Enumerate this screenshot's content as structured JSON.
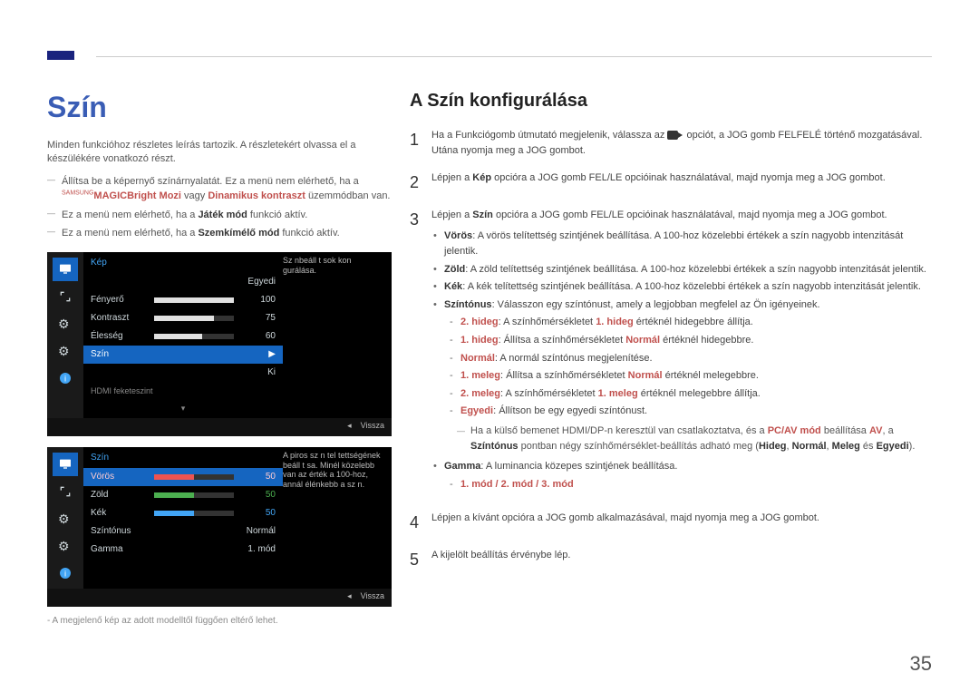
{
  "page_number": "35",
  "section_title": "Szín",
  "intro": "Minden funkcióhoz részletes leírás tartozik. A részletekért olvassa el a készülékére vonatkozó részt.",
  "dash_items": {
    "d1_pre": "Állítsa be a képernyő színárnyalatát. Ez a menü nem elérhető, ha a ",
    "d1_brand_sup": "SAMSUNG",
    "d1_brand_sub": "MAGIC",
    "d1_bright": "Bright",
    "d1_post1": "Mozi",
    "d1_post2": " vagy ",
    "d1_post3": "Dinamikus kontraszt",
    "d1_post4": " üzemmódban van.",
    "d2_pre": "Ez a menü nem elérhető, ha a ",
    "d2_bold": "Játék mód",
    "d2_post": " funkció aktív.",
    "d3_pre": "Ez a menü nem elérhető, ha a ",
    "d3_bold": "Szemkímélő mód",
    "d3_post": " funkció aktív."
  },
  "osd1": {
    "title": "Kép",
    "hint": "Sz nbeáll t sok kon gurálása.",
    "rows": [
      {
        "label": "Fényerő",
        "val": "100",
        "fill": 100
      },
      {
        "label": "Kontraszt",
        "val": "75",
        "fill": 75
      },
      {
        "label": "Élesség",
        "val": "60",
        "fill": 60
      }
    ],
    "highlight_label": "Szín",
    "value_egyedi": "Egyedi",
    "ki": "Ki",
    "hdmi": "HDMI feketeszint",
    "footer": "Vissza"
  },
  "osd2": {
    "title": "Szín",
    "hint": "A piros sz n tel tettségének beáll t sa. Minél közelebb van az érték a 100-hoz, annál élénkebb a sz n.",
    "rows": [
      {
        "label": "Vörös",
        "val": "50",
        "fill": 50,
        "color": "red"
      },
      {
        "label": "Zöld",
        "val": "50",
        "fill": 50,
        "color": "green"
      },
      {
        "label": "Kék",
        "val": "50",
        "fill": 50,
        "color": "blue"
      }
    ],
    "tone_label": "Színtónus",
    "tone_val": "Normál",
    "gamma_label": "Gamma",
    "gamma_val": "1. mód",
    "footer": "Vissza"
  },
  "caption": "- A megjelenő kép az adott modelltől függően eltérő lehet.",
  "config_title": "A Szín konfigurálása",
  "steps": {
    "s1a": "Ha a Funkciógomb útmutató megjelenik, válassza az ",
    "s1b": " opciót, a JOG gomb FELFELÉ történő mozgatásával. Utána nyomja meg a JOG gombot.",
    "s2a": "Lépjen a ",
    "s2b": "Kép",
    "s2c": " opcióra a JOG gomb FEL/LE opcióinak használatával, majd nyomja meg a JOG gombot.",
    "s3a": "Lépjen a ",
    "s3b": "Szín",
    "s3c": " opcióra a JOG gomb FEL/LE opcióinak használatával, majd nyomja meg a JOG gombot.",
    "s4": "Lépjen a kívánt opcióra a JOG gomb alkalmazásával, majd nyomja meg a JOG gombot.",
    "s5": "A kijelölt beállítás érvénybe lép."
  },
  "bullets": {
    "b1a": "Vörös",
    "b1b": ": A vörös telítettség szintjének beállítása. A 100-hoz közelebbi értékek a szín nagyobb intenzitását jelentik.",
    "b2a": "Zöld",
    "b2b": ": A zöld telítettség szintjének beállítása. A 100-hoz közelebbi értékek a szín nagyobb intenzitását jelentik.",
    "b3a": "Kék",
    "b3b": ": A kék telítettség szintjének beállítása. A 100-hoz közelebbi értékek a szín nagyobb intenzitását jelentik.",
    "b4a": "Színtónus",
    "b4b": ": Válasszon egy színtónust, amely a legjobban megfelel az Ön igényeinek.",
    "sb1a": "2. hideg",
    "sb1b": ": A színhőmérsékletet ",
    "sb1c": "1. hideg",
    "sb1d": " értéknél hidegebbre állítja.",
    "sb2a": "1. hideg",
    "sb2b": ": Állítsa a színhőmérsékletet ",
    "sb2c": "Normál",
    "sb2d": " értéknél hidegebbre.",
    "sb3a": "Normál",
    "sb3b": ": A normál színtónus megjelenítése.",
    "sb4a": "1. meleg",
    "sb4b": ": Állítsa a színhőmérsékletet ",
    "sb4c": "Normál",
    "sb4d": " értéknél melegebbre.",
    "sb5a": "2. meleg",
    "sb5b": ": A színhőmérsékletet ",
    "sb5c": "1. meleg",
    "sb5d": " értéknél melegebbre állítja.",
    "sb6a": "Egyedi",
    "sb6b": ": Állítson be egy egyedi színtónust.",
    "note_pre": "Ha a külső bemenet HDMI/DP-n keresztül van csatlakoztatva, és a ",
    "note_pcav": "PC/AV mód",
    "note_mid1": " beállítása ",
    "note_av": "AV",
    "note_mid2": ", a ",
    "note_szin": "Színtónus",
    "note_mid3": " pontban négy színhőmérséklet-beállítás adható meg (",
    "note_h": "Hideg",
    "note_c1": ", ",
    "note_n": "Normál",
    "note_c2": ", ",
    "note_m": "Meleg",
    "note_c3": " és ",
    "note_e": "Egyedi",
    "note_end": ").",
    "b5a": "Gamma",
    "b5b": ": A luminancia közepes szintjének beállítása.",
    "sb7": "1. mód / 2. mód / 3. mód"
  }
}
